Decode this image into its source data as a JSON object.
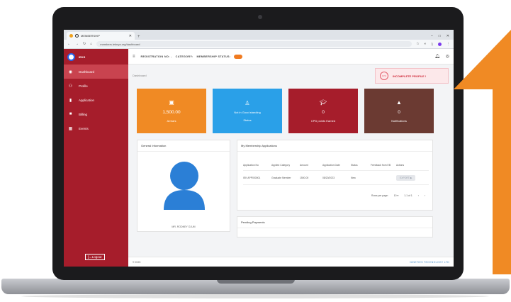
{
  "browser": {
    "tab_title": "MEMBERSHIP",
    "url": "members.ieknya.org/dashboard",
    "new_tab": "+",
    "window_controls": [
      "–",
      "□",
      "✕"
    ]
  },
  "sidebar": {
    "brand": "IEKS",
    "items": [
      {
        "label": "Dashboard",
        "icon": "user-circle-icon",
        "active": true
      },
      {
        "label": "Profile",
        "icon": "profile-icon",
        "active": false
      },
      {
        "label": "Application",
        "icon": "document-icon",
        "active": false
      },
      {
        "label": "Billing",
        "icon": "billing-icon",
        "active": false
      },
      {
        "label": "Events",
        "icon": "events-icon",
        "active": false
      }
    ],
    "logout": "[→Logout"
  },
  "topbar": {
    "registration": "REGISTRATION NO: -",
    "category": "CATEGORY:",
    "membership_status": "MEMBERSHIP STATUS:"
  },
  "breadcrumb": "Dashboard",
  "alert": {
    "percent": "10%",
    "text": "INCOMPLETE PROFILE !"
  },
  "cards": [
    {
      "value": "1,500.00",
      "label": "Arrears",
      "color": "#f08a24",
      "icon": "money-icon"
    },
    {
      "value": "",
      "label": "Not in Good standing",
      "sublabel": "Status",
      "color": "#2aa0e8",
      "icon": "user-check-icon"
    },
    {
      "value": "0",
      "label": "CPD points Earned",
      "color": "#a61d2b",
      "icon": "graduation-icon"
    },
    {
      "value": "0",
      "label": "Notifications",
      "color": "#6b3a32",
      "icon": "bell-icon"
    }
  ],
  "general_info": {
    "title": "General Information",
    "name": "MR. RODNEY OJUM"
  },
  "applications": {
    "title": "My Membership Applications",
    "headers": [
      "Application No",
      "Applied Category",
      "Amount",
      "Application Date",
      "Status",
      "Feedback from EB",
      "Actions"
    ],
    "rows": [
      {
        "app_no": "IEK APP000001",
        "category": "Graduate Member",
        "amount": "1500.00",
        "date": "08/20/2023",
        "status": "New",
        "feedback": "",
        "action": "EXPORT"
      }
    ],
    "rows_per_page_label": "Rows per page:",
    "rows_per_page": "10",
    "range": "1-1 of 1"
  },
  "pending_payments": {
    "title": "Pending Payments"
  },
  "footer": {
    "left": "© 2023",
    "right": "NINETIES TECHNOLOGY LTD"
  },
  "colors": {
    "accent": "#a61d2b",
    "arrow": "#f08a24"
  }
}
